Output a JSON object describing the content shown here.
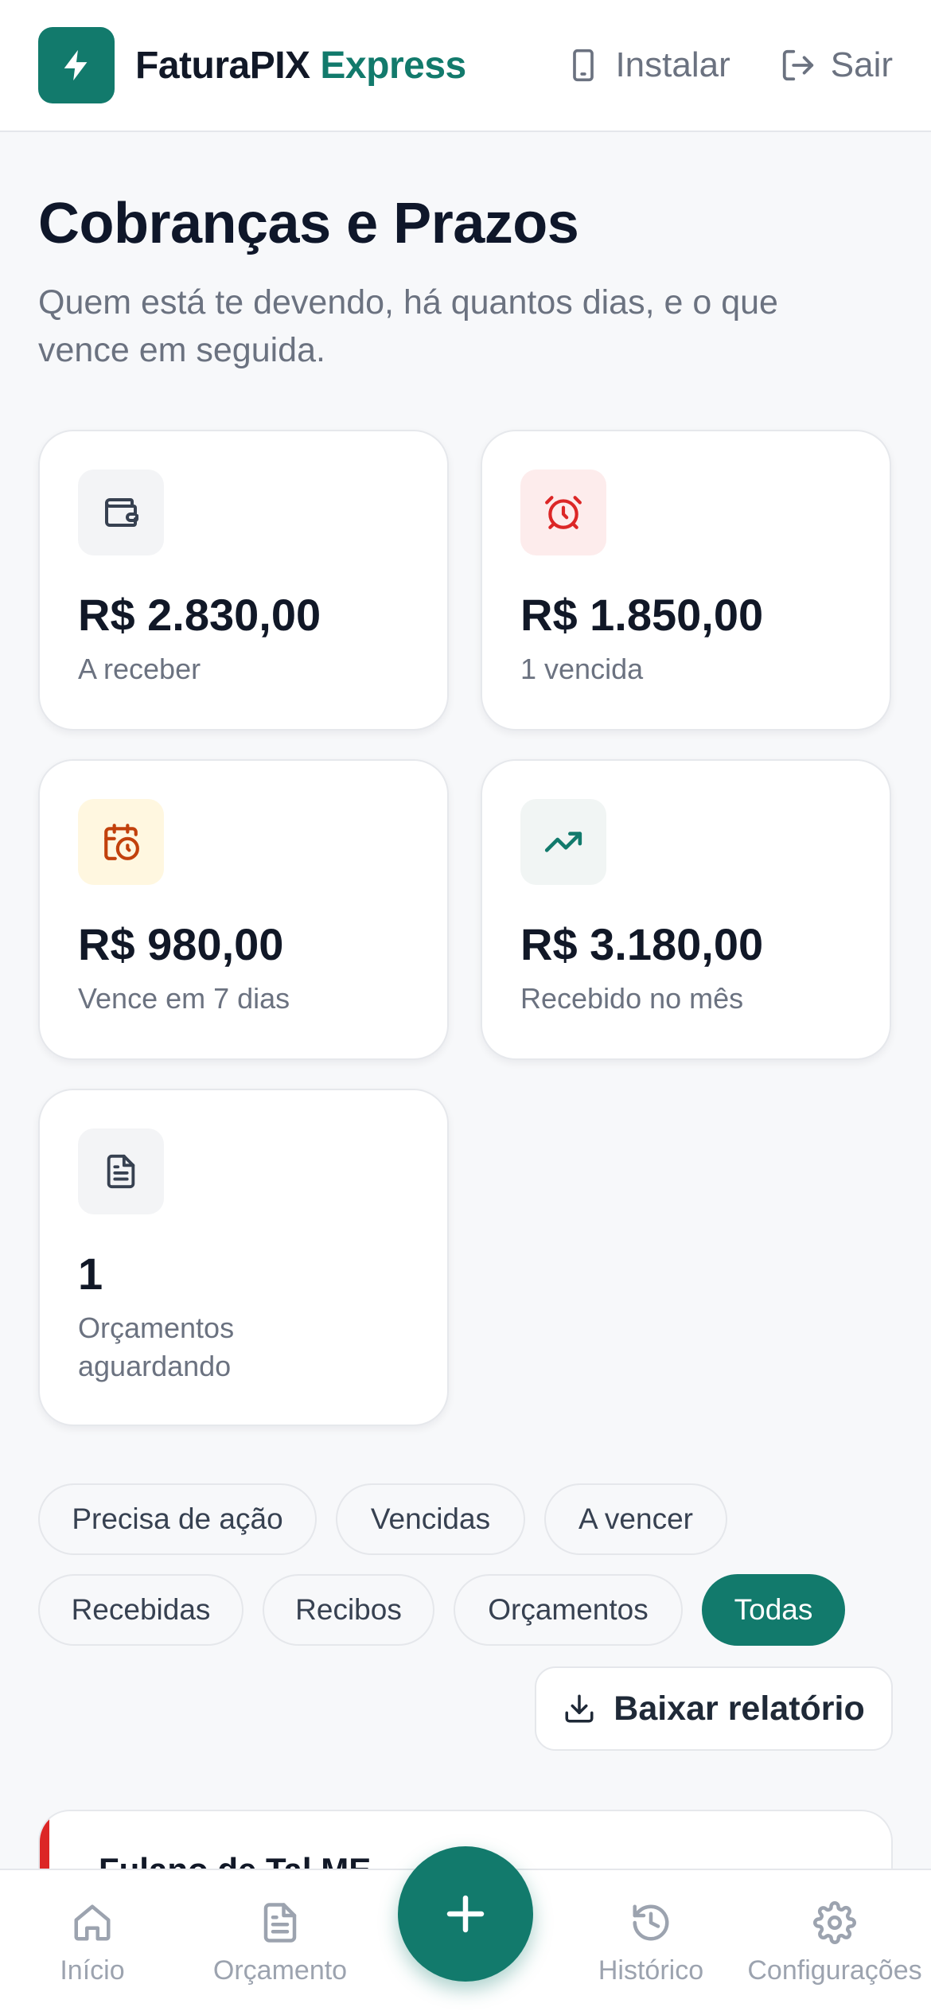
{
  "header": {
    "brand_main": "FaturaPIX",
    "brand_accent": "Express",
    "install_label": "Instalar",
    "logout_label": "Sair"
  },
  "page": {
    "title": "Cobranças e Prazos",
    "subtitle": "Quem está te devendo, há quantos dias, e o que vence em seguida."
  },
  "stats": [
    {
      "value": "R$ 2.830,00",
      "label": "A receber",
      "icon": "wallet-icon"
    },
    {
      "value": "R$ 1.850,00",
      "label": "1 vencida",
      "icon": "alarm-clock-icon"
    },
    {
      "value": "R$ 980,00",
      "label": "Vence em 7 dias",
      "icon": "calendar-clock-icon"
    },
    {
      "value": "R$ 3.180,00",
      "label": "Recebido no mês",
      "icon": "trending-up-icon"
    },
    {
      "value": "1",
      "label": "Orçamentos aguardando",
      "icon": "document-icon"
    }
  ],
  "filters": [
    {
      "label": "Precisa de ação",
      "active": false
    },
    {
      "label": "Vencidas",
      "active": false
    },
    {
      "label": "A vencer",
      "active": false
    },
    {
      "label": "Recebidas",
      "active": false
    },
    {
      "label": "Recibos",
      "active": false
    },
    {
      "label": "Orçamentos",
      "active": false
    },
    {
      "label": "Todas",
      "active": true
    }
  ],
  "report_button": "Baixar relatório",
  "list": [
    {
      "client": "Fulano de Tal ME",
      "status_color": "#dc2626"
    }
  ],
  "bottom_nav": [
    {
      "label": "Início",
      "icon": "home-icon"
    },
    {
      "label": "Orçamento",
      "icon": "document-icon"
    },
    {
      "label": "Histórico",
      "icon": "history-icon"
    },
    {
      "label": "Configurações",
      "icon": "gear-icon"
    }
  ],
  "colors": {
    "brand": "#127a6c",
    "danger": "#dc2626",
    "warning": "#c2410c"
  }
}
